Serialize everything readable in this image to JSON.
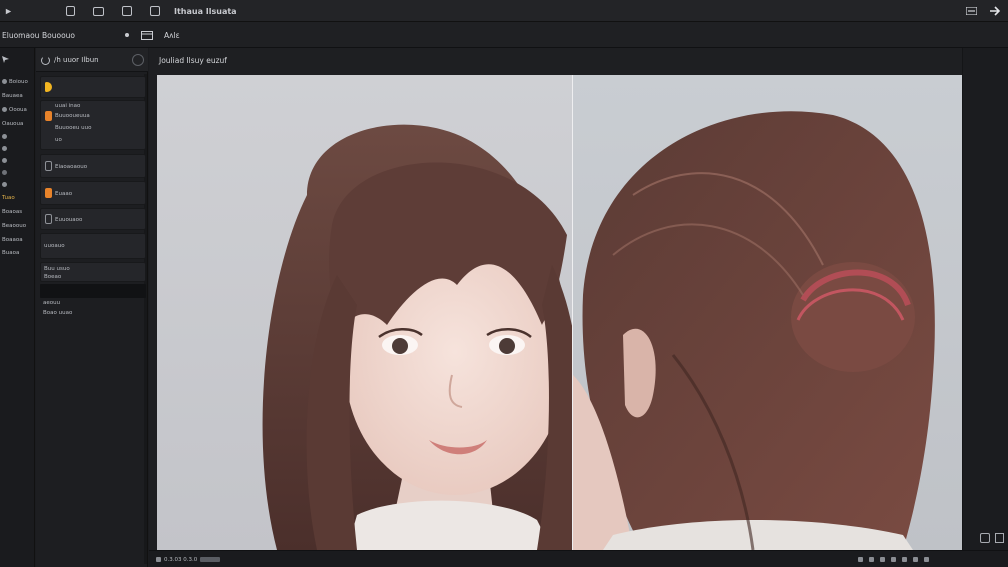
{
  "topbar": {
    "menu_label": "",
    "title": "Ithaua Ilsuata"
  },
  "subbar": {
    "left_label": "Eluomaou",
    "tab_label": "Bouoouo",
    "zoom_label": "Aʌlɛ"
  },
  "left_column": {
    "items": [
      "Boiouo",
      "Bauaea",
      "Oooua",
      "Oauoua",
      "",
      "",
      "",
      "",
      "Tuao",
      "Boaoas",
      "Beaoouo",
      "Boaaoa",
      "Buaoa"
    ]
  },
  "panel": {
    "title": "/h uuor Ilbun",
    "rows": [
      {
        "lines": [
          "uuai inao",
          "Buuooueuua",
          "Buuooeu uuo",
          "uo"
        ]
      },
      {
        "lines": [
          "Eiaoaoaouo"
        ]
      },
      {
        "lines": [
          "Euaao"
        ]
      },
      {
        "lines": [
          "Euuouaoo"
        ]
      },
      {
        "lines": [
          "uuoauo"
        ]
      },
      {
        "lines": [
          "Buu usuo",
          "Boeao"
        ]
      },
      {
        "lines": [
          "aeouu",
          "Boao uuao"
        ]
      }
    ]
  },
  "canvas": {
    "title": "Jouliad Ilsuy euzuf"
  },
  "status": {
    "left": "0.3.03   0.3.0"
  },
  "colors": {
    "accent_orange": "#e8832a",
    "accent_yellow": "#f2b521"
  },
  "images": [
    {
      "name": "portrait-front",
      "subject": "girl with long auburn hair, front view"
    },
    {
      "name": "portrait-back",
      "subject": "girl with hair bun, back view"
    }
  ]
}
